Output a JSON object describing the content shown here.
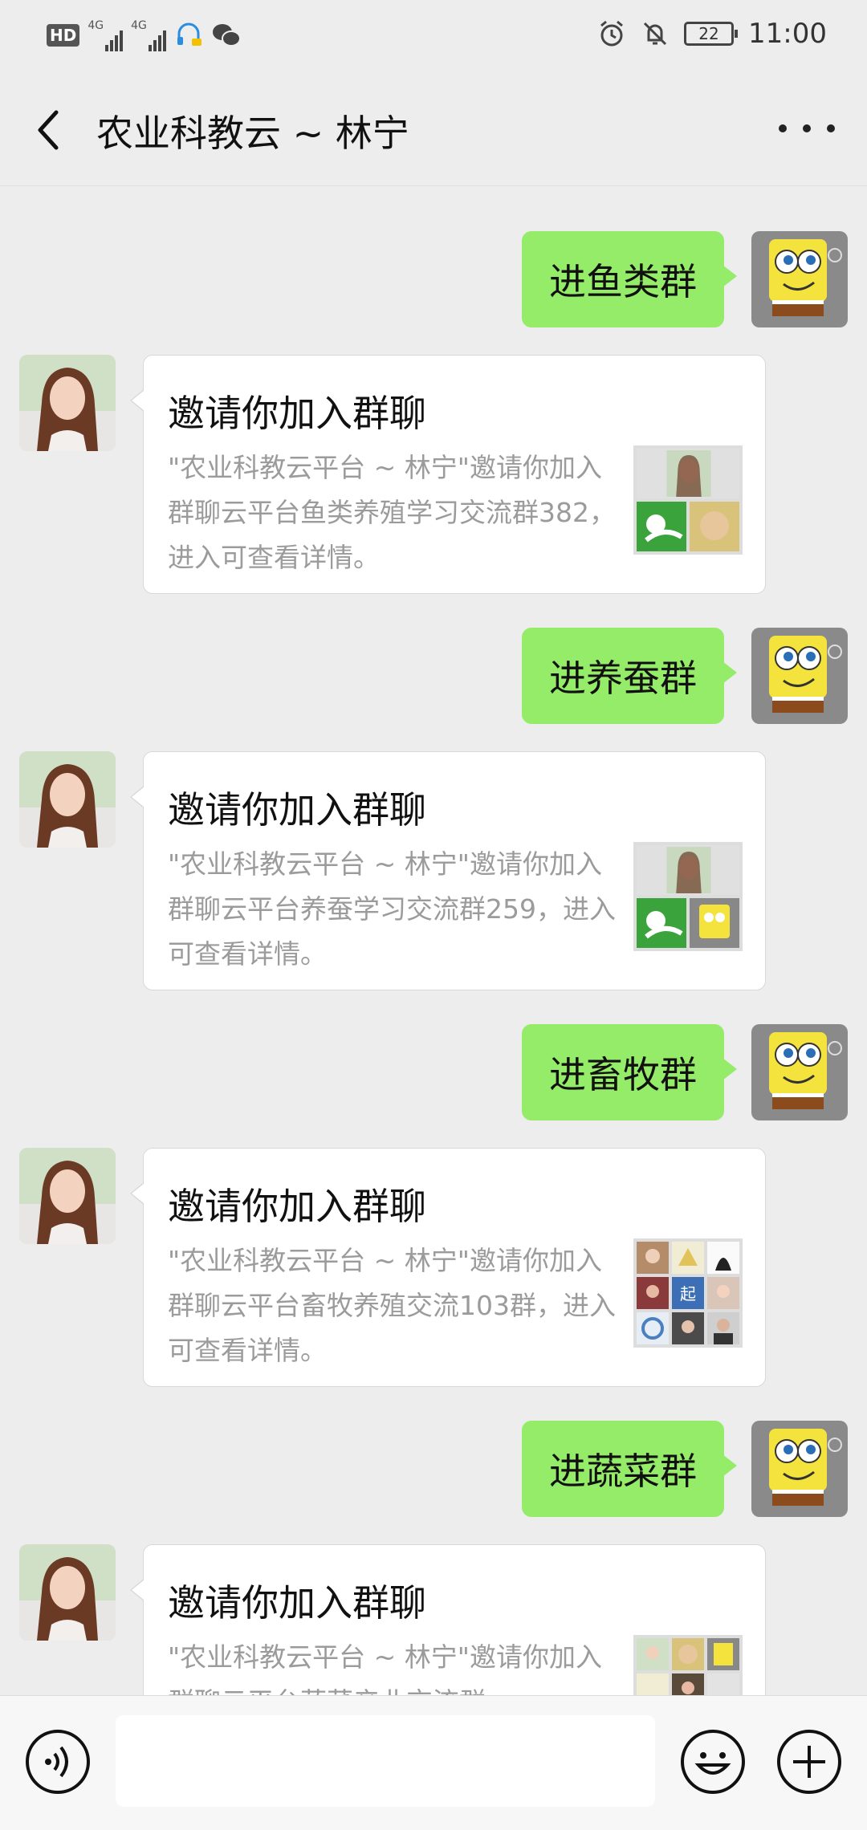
{
  "status_bar": {
    "hd": "HD",
    "network_1": "4G",
    "network_2": "4G",
    "battery": "22",
    "time": "11:00"
  },
  "header": {
    "title": "农业科教云 ~ 林宁"
  },
  "messages": [
    {
      "type": "outgoing",
      "text": "进鱼类群"
    },
    {
      "type": "invite",
      "title": "邀请你加入群聊",
      "desc": "\"农业科教云平台 ~ 林宁\"邀请你加入群聊云平台鱼类养殖学习交流群382，进入可查看详情。"
    },
    {
      "type": "outgoing",
      "text": "进养蚕群"
    },
    {
      "type": "invite",
      "title": "邀请你加入群聊",
      "desc": "\"农业科教云平台 ~ 林宁\"邀请你加入群聊云平台养蚕学习交流群259，进入可查看详情。"
    },
    {
      "type": "outgoing",
      "text": "进畜牧群"
    },
    {
      "type": "invite",
      "title": "邀请你加入群聊",
      "desc": "\"农业科教云平台 ~ 林宁\"邀请你加入群聊云平台畜牧养殖交流103群，进入可查看详情。"
    },
    {
      "type": "outgoing",
      "text": "进蔬菜群"
    },
    {
      "type": "invite",
      "title": "邀请你加入群聊",
      "desc": "\"农业科教云平台 ~ 林宁\"邀请你加入群聊云平台蔬菜产业交流群"
    }
  ],
  "input_bar": {
    "placeholder": ""
  },
  "icons": [
    "back-arrow-icon",
    "more-dots-icon",
    "voice-icon",
    "emoji-icon",
    "plus-icon",
    "alarm-icon",
    "mute-bell-icon",
    "signal-icon",
    "headset-icon",
    "wechat-icon"
  ],
  "colors": {
    "background": "#ededed",
    "outgoing_bubble": "#95ec69",
    "card": "#ffffff",
    "desc_text": "#9b9b9b"
  }
}
